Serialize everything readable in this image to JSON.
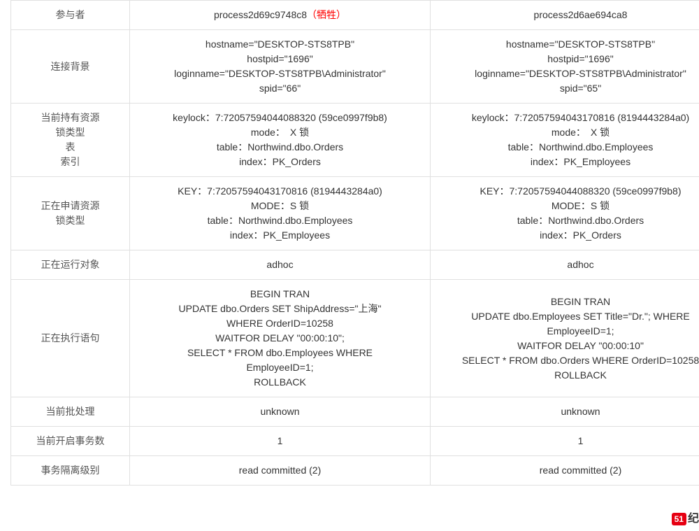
{
  "headers": {
    "participant": "参与者",
    "connection": "连接背景",
    "holding": "当前持有资源",
    "lock_type": "锁类型",
    "table_label": "表",
    "index_label": "索引",
    "requesting": "正在申请资源",
    "running_object": "正在运行对象",
    "executing_sql": "正在执行语句",
    "batch": "当前批处理",
    "trans_count": "当前开启事务数",
    "isolation": "事务隔离级别"
  },
  "victim_suffix": "（牺牲）",
  "p1": {
    "id": "process2d69c9748c8",
    "conn_l1": "hostname=\"DESKTOP-STS8TPB\"",
    "conn_l2": "hostpid=\"1696\"",
    "conn_l3": "loginname=\"DESKTOP-STS8TPB\\Administrator\"",
    "conn_l4": "spid=\"66\"",
    "hold_l1": "keylock：7:72057594044088320 (59ce0997f9b8)",
    "hold_l2": "mode：　X 锁",
    "hold_l3": "table：Northwind.dbo.Orders",
    "hold_l4": "index：PK_Orders",
    "req_l1": "KEY：7:72057594043170816 (8194443284a0)",
    "req_l2": "MODE：S 锁",
    "req_l3": "table：Northwind.dbo.Employees",
    "req_l4": "index：PK_Employees",
    "object": "adhoc",
    "sql_l1": "BEGIN TRAN",
    "sql_l2": "UPDATE  dbo.Orders SET  ShipAddress=\"上海\"",
    "sql_l3": "WHERE OrderID=10258",
    "sql_l4": "WAITFOR DELAY \"00:00:10\";",
    "sql_l5": "SELECT * FROM dbo.Employees WHERE",
    "sql_l6": "EmployeeID=1;",
    "sql_l7": "ROLLBACK",
    "batch": "unknown",
    "trans_count": "1",
    "isolation": "read committed (2)"
  },
  "p2": {
    "id": "process2d6ae694ca8",
    "conn_l1": "hostname=\"DESKTOP-STS8TPB\"",
    "conn_l2": "hostpid=\"1696\"",
    "conn_l3": "loginname=\"DESKTOP-STS8TPB\\Administrator\"",
    "conn_l4": "spid=\"65\"",
    "hold_l1": "keylock：7:72057594043170816 (8194443284a0)",
    "hold_l2": "mode：　X 锁",
    "hold_l3": "table：Northwind.dbo.Employees",
    "hold_l4": "index：PK_Employees",
    "req_l1": "KEY：7:72057594044088320 (59ce0997f9b8)",
    "req_l2": "MODE：S 锁",
    "req_l3": "table：Northwind.dbo.Orders",
    "req_l4": "index：PK_Orders",
    "object": "adhoc",
    "sql_l1": "BEGIN TRAN",
    "sql_l2": "UPDATE dbo.Employees SET Title=\"Dr.\"; WHERE",
    "sql_l3": "EmployeeID=1;",
    "sql_l4": "WAITFOR DELAY \"00:00:10\"",
    "sql_l5": "SELECT * FROM dbo.Orders WHERE OrderID=10258",
    "sql_l6": "ROLLBACK",
    "sql_l7": "",
    "batch": "unknown",
    "trans_count": "1",
    "isolation": "read committed (2)"
  },
  "logo": {
    "badge": "51",
    "text": "纪"
  }
}
